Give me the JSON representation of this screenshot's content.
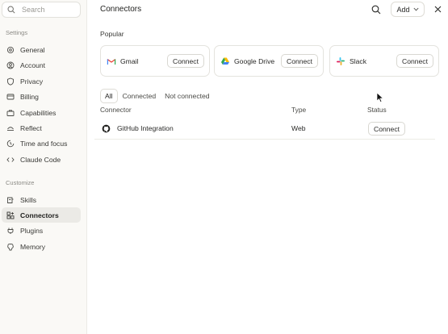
{
  "sidebar": {
    "search_placeholder": "Search",
    "sections": [
      {
        "label": "Settings",
        "items": [
          {
            "label": "General",
            "icon": "gear-icon"
          },
          {
            "label": "Account",
            "icon": "user-icon"
          },
          {
            "label": "Privacy",
            "icon": "shield-icon"
          },
          {
            "label": "Billing",
            "icon": "card-icon"
          },
          {
            "label": "Capabilities",
            "icon": "briefcase-icon"
          },
          {
            "label": "Reflect",
            "icon": "reflect-icon"
          },
          {
            "label": "Time and focus",
            "icon": "clock-icon"
          },
          {
            "label": "Claude Code",
            "icon": "code-icon"
          }
        ]
      },
      {
        "label": "Customize",
        "items": [
          {
            "label": "Skills",
            "icon": "skills-icon"
          },
          {
            "label": "Connectors",
            "icon": "connectors-icon",
            "active": true
          },
          {
            "label": "Plugins",
            "icon": "plug-icon"
          },
          {
            "label": "Memory",
            "icon": "memory-icon"
          }
        ]
      }
    ]
  },
  "header": {
    "title": "Connectors",
    "add_label": "Add"
  },
  "popular": {
    "label": "Popular",
    "cards": [
      {
        "name": "Gmail",
        "icon": "gmail-icon",
        "button": "Connect"
      },
      {
        "name": "Google Drive",
        "icon": "google-drive-icon",
        "button": "Connect"
      },
      {
        "name": "Slack",
        "icon": "slack-icon",
        "button": "Connect"
      }
    ]
  },
  "filters": {
    "tabs": [
      "All",
      "Connected",
      "Not connected"
    ],
    "active": "All"
  },
  "table": {
    "headers": {
      "connector": "Connector",
      "type": "Type",
      "status": "Status"
    },
    "rows": [
      {
        "connector": "GitHub Integration",
        "icon": "github-icon",
        "type": "Web",
        "status_button": "Connect"
      }
    ]
  },
  "colors": {
    "sidebar_bg": "#faf9f6",
    "active_item_bg": "#ebeae6",
    "border": "#e4e3de"
  }
}
